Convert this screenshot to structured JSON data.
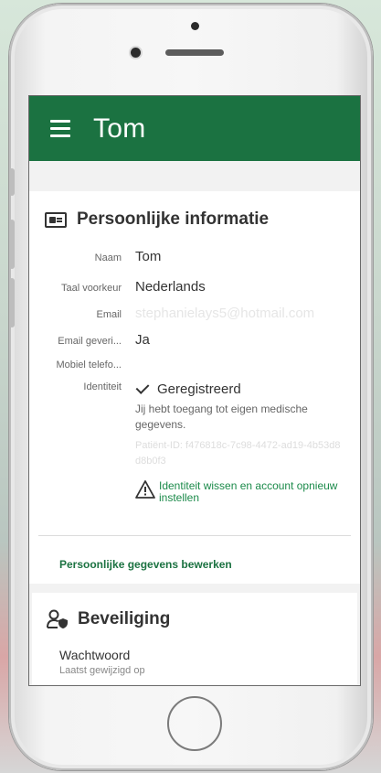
{
  "appbar": {
    "title": "Tom"
  },
  "personal": {
    "heading": "Persoonlijke informatie",
    "rows": [
      {
        "label": "Naam",
        "value": "Tom"
      },
      {
        "label": "Taal voorkeur",
        "value": "Nederlands"
      },
      {
        "label": "Email",
        "value": "stephanielays5@hotmail.com"
      },
      {
        "label": "Email geveri...",
        "value": "Ja"
      },
      {
        "label": "Mobiel telefo...",
        "value": ""
      }
    ],
    "identity": {
      "label": "Identiteit",
      "status": "Geregistreerd",
      "description": "Jij hebt toegang tot eigen medische gegevens.",
      "patient_id": "Patiënt-ID: f476818c-7c98-4472-ad19-4b53d8d8b0f3",
      "reset_link": "Identiteit wissen en account opnieuw instellen"
    },
    "edit_link": "Persoonlijke gegevens bewerken"
  },
  "security": {
    "heading": "Beveiliging",
    "password_label": "Wachtwoord",
    "password_changed": "Laatst gewijzigd op"
  },
  "colors": {
    "primary": "#1b7241",
    "link": "#1b8a4a"
  }
}
